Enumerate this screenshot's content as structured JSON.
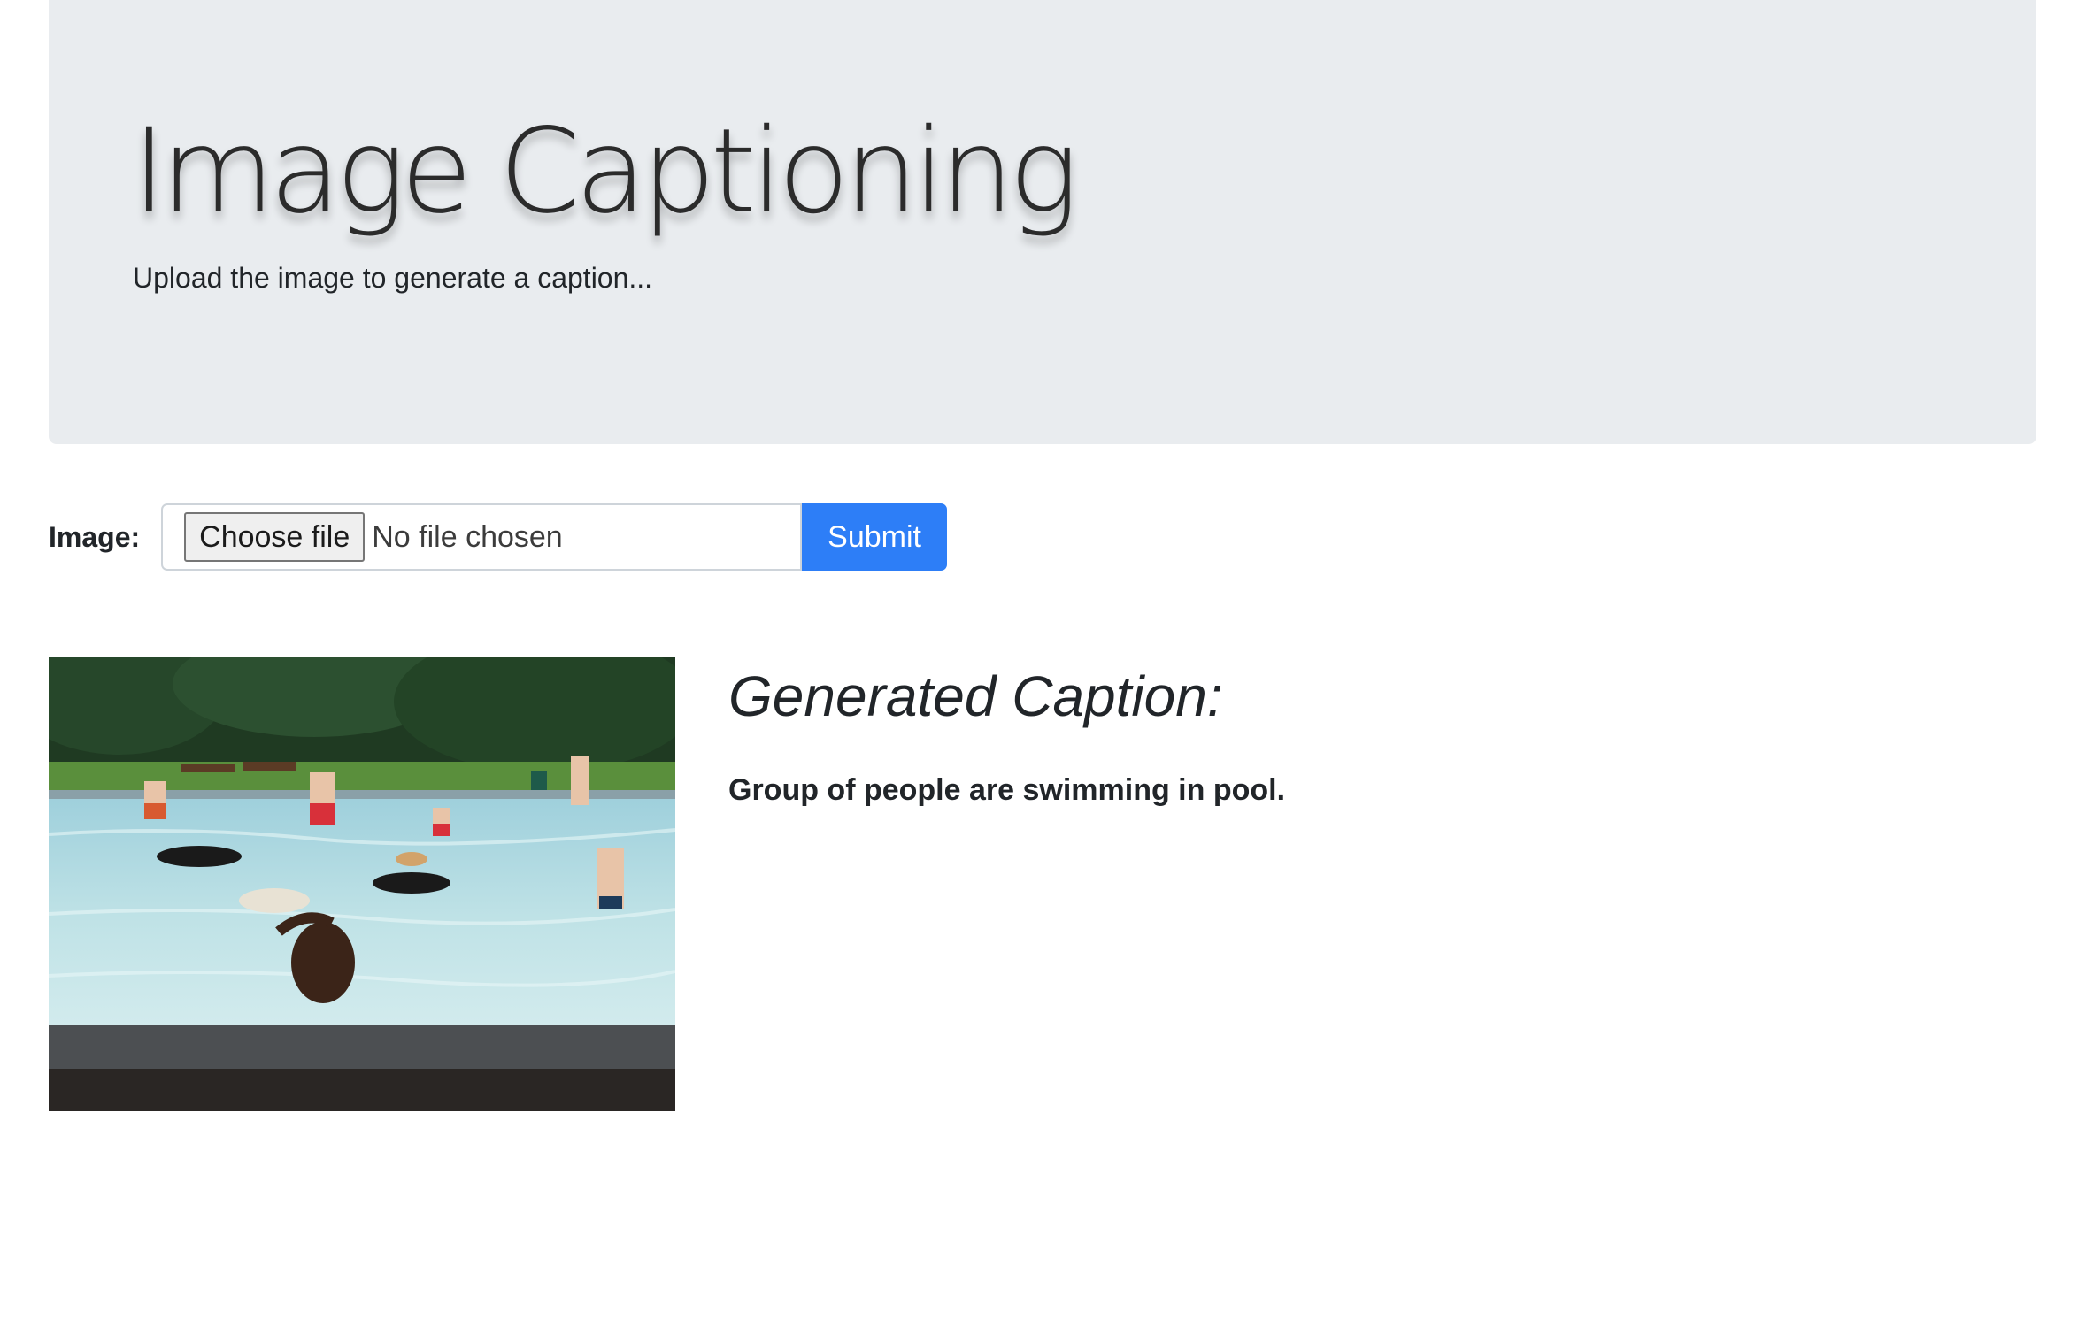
{
  "jumbotron": {
    "title": "Image Captioning",
    "lead": "Upload the image to generate a caption..."
  },
  "form": {
    "label": "Image:",
    "choose_file_label": "Choose file",
    "file_status": "No file chosen",
    "submit_label": "Submit"
  },
  "result": {
    "image_icon": "uploaded-photo-pool-with-people-and-dogs",
    "heading": "Generated Caption:",
    "caption": "Group of people are swimming in pool."
  },
  "colors": {
    "jumbotron_bg": "#e9ecef",
    "primary": "#2d7ef7",
    "text": "#212529"
  }
}
